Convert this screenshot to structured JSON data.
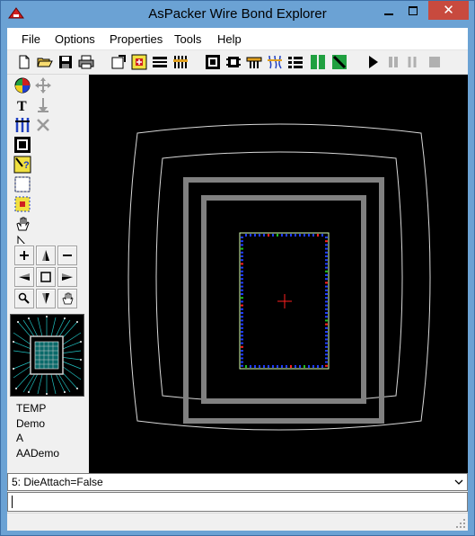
{
  "window": {
    "title": "AsPacker Wire Bond Explorer",
    "close_symbol": "✕",
    "minimize_icon": "minimize-icon",
    "maximize_icon": "maximize-icon"
  },
  "menu": {
    "items": [
      {
        "label": "File"
      },
      {
        "label": "Options"
      },
      {
        "label": "Properties"
      },
      {
        "label": "Tools"
      },
      {
        "label": "Help"
      }
    ]
  },
  "info": {
    "lines": [
      "TEMP",
      "Demo",
      "A",
      "AADemo"
    ]
  },
  "combo": {
    "selected": "5: DieAttach=False"
  },
  "command_input": {
    "value": ""
  },
  "colors": {
    "canvas_bg": "#000000",
    "ring_gray": "#808080",
    "ring_white": "#d9d9d9",
    "die_outline": "#d9ffb3",
    "pad_blue": "#1e3cff",
    "pad_red": "#ff2020",
    "pad_green": "#20c020",
    "crosshair": "#ff2020",
    "title_bg": "#6ba2d4",
    "close_bg": "#c84a3e"
  }
}
